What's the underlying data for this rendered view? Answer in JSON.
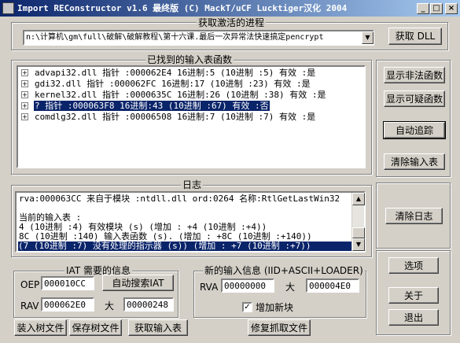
{
  "window": {
    "title": "Import REConstructor v1.6 最终版 (C) MackT/uCF Lucktiger汉化 2004",
    "minimize": "_",
    "maximize": "□",
    "close": "×"
  },
  "process_group": {
    "label": "获取激活的进程",
    "selected_process": "n:\\计算机\\gm\\full\\破解\\破解教程\\第十六课.最后一次异常法快速搞定pencrypt",
    "get_dll_button": "获取 DLL"
  },
  "imports_group": {
    "label": "已找到的输入表函数",
    "rows": [
      {
        "expander": "+",
        "text": "advapi32.dll 指针  :000062E4 16进制:5 (10进制 :5) 有效 :是",
        "selected": false
      },
      {
        "expander": "+",
        "text": "gdi32.dll 指针  :000062FC 16进制:17 (10进制 :23) 有效 :是",
        "selected": false
      },
      {
        "expander": "+",
        "text": "kernel32.dll 指针  :0000635C 16进制:26 (10进制 :38) 有效 :是",
        "selected": false
      },
      {
        "expander": "+",
        "text": "? 指针  :000063F8 16进制:43 (10进制 :67) 有效 :否",
        "selected": true
      },
      {
        "expander": "+",
        "text": "comdlg32.dll 指针  :00006508 16进制:7 (10进制 :7) 有效 :是",
        "selected": false
      }
    ]
  },
  "right_buttons": {
    "show_invalid": "显示非法函数",
    "show_suspect": "显示可疑函数",
    "auto_trace": "自动追踪",
    "clear_imports": "清除输入表",
    "clear_log": "清除日志",
    "options": "选项",
    "about": "关于",
    "exit": "退出"
  },
  "log_group": {
    "label": "日志",
    "lines": [
      {
        "text": "rva:000063CC 来自于模块        :ntdll.dll ord:0264 名称:RtlGetLastWin32",
        "selected": false
      },
      {
        "text": "",
        "selected": false
      },
      {
        "text": "当前的输入表   :",
        "selected": false
      },
      {
        "text": "4 (10进制 :4) 有效模块     (s) (增加 : +4 (10进制 :+4))",
        "selected": false
      },
      {
        "text": "8C (10进制 :140) 输入表函数      (s). (增加 : +8C (10进制 :+140))",
        "selected": false
      },
      {
        "text": "(7 (10进制 :7) 没有处理的指示器  (s)) (增加 : +7 (10进制 :+7))",
        "selected": true
      }
    ]
  },
  "iat_group": {
    "label": "IAT 需要的信息",
    "oep_label": "OEP",
    "oep_value": "000010CC",
    "auto_search_button": "自动搜索IAT",
    "rva_label": "RAV",
    "rva_value": "000062E0",
    "size_label": "大",
    "size_value": "00000248"
  },
  "new_import_group": {
    "label": "新的输入信息 (IID+ASCII+LOADER)",
    "rva_label": "RVA",
    "rva_value": "00000000",
    "size_label": "大",
    "size_value": "000004E0",
    "add_section_label": "增加新块",
    "add_section_checked": true,
    "check_mark": "✓"
  },
  "bottom_buttons": {
    "load_tree": "装入树文件",
    "save_tree": "保存树文件",
    "get_imports": "获取输入表",
    "fix_dump": "修复抓取文件"
  },
  "icons": {
    "app": "app-icon",
    "dropdown": "chevron-down-icon",
    "scroll_up": "arrow-up-icon",
    "scroll_down": "arrow-down-icon"
  }
}
